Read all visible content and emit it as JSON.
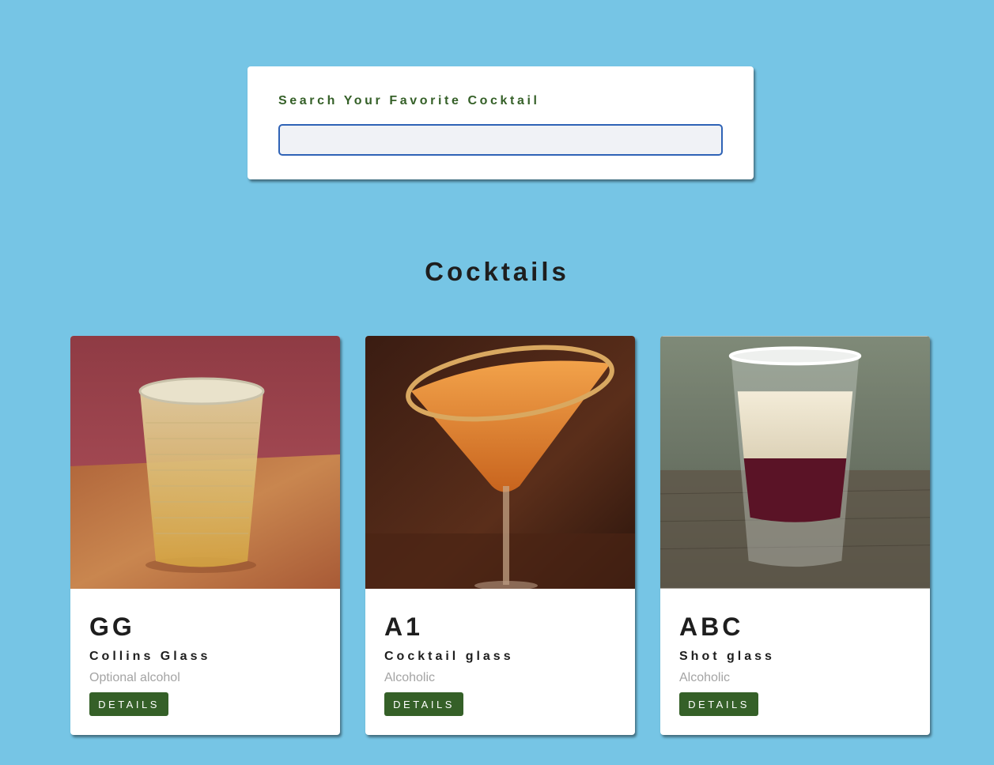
{
  "search": {
    "label": "Search Your Favorite Cocktail",
    "value": ""
  },
  "section": {
    "title": "Cocktails"
  },
  "cocktails": [
    {
      "name": "GG",
      "glass": "Collins Glass",
      "info": "Optional alcohol",
      "button": "DETAILS",
      "image": "cocktail-photo"
    },
    {
      "name": "A1",
      "glass": "Cocktail glass",
      "info": "Alcoholic",
      "button": "DETAILS",
      "image": "cocktail-photo"
    },
    {
      "name": "ABC",
      "glass": "Shot glass",
      "info": "Alcoholic",
      "button": "DETAILS",
      "image": "cocktail-photo"
    }
  ],
  "colors": {
    "background": "#76c5e5",
    "accent": "#356028",
    "input_border": "#2f63b6"
  }
}
